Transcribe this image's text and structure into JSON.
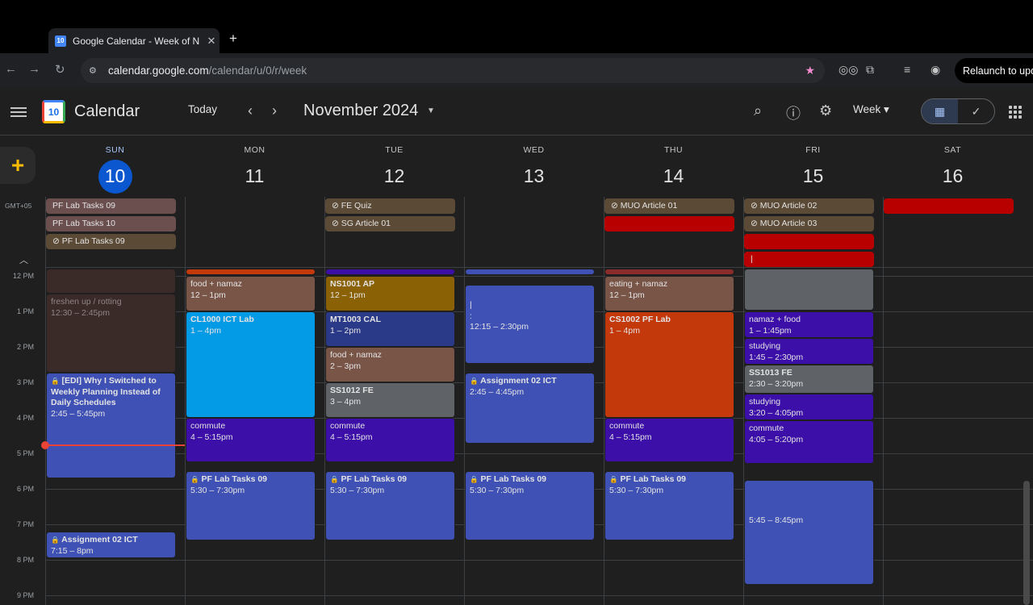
{
  "browser": {
    "tab_title": "Google Calendar - Week of N",
    "new_tab": "+",
    "url_host": "calendar.google.com",
    "url_path": "/calendar/u/0/r/week",
    "relaunch": "Relaunch to upd"
  },
  "header": {
    "app_name": "Calendar",
    "logo_day": "10",
    "today": "Today",
    "prev": "‹",
    "next": "›",
    "month": "November 2024",
    "view": "Week"
  },
  "timezone": "GMT+05",
  "days": [
    {
      "dow": "SUN",
      "num": "10"
    },
    {
      "dow": "MON",
      "num": "11"
    },
    {
      "dow": "TUE",
      "num": "12"
    },
    {
      "dow": "WED",
      "num": "13"
    },
    {
      "dow": "THU",
      "num": "14"
    },
    {
      "dow": "FRI",
      "num": "15"
    },
    {
      "dow": "SAT",
      "num": "16"
    }
  ],
  "hours": [
    "12 PM",
    "1 PM",
    "2 PM",
    "3 PM",
    "4 PM",
    "5 PM",
    "6 PM",
    "7 PM",
    "8 PM",
    "9 PM"
  ],
  "allday": {
    "sun1": "PF Lab Tasks 09",
    "sun2": "PF Lab Tasks 10",
    "sun3": "PF Lab Tasks 09",
    "tue1": "FE Quiz",
    "tue2": "SG Article 01",
    "thu1": "MUO Article 01",
    "fri1": "MUO Article 02",
    "fri2": "MUO Article 03",
    "fri4": "|"
  },
  "events": {
    "sun_fresh": {
      "title": "freshen up / rotting",
      "time": "12:30 – 2:45pm"
    },
    "sun_edi": {
      "title": "[EDI] Why I Switched to Weekly Planning Instead of Daily Schedules",
      "time": "2:45 – 5:45pm"
    },
    "sun_assign": {
      "title": "Assignment 02 ICT",
      "time": "7:15 – 8pm"
    },
    "mon_food": {
      "title": "food + namaz",
      "time": "12 – 1pm"
    },
    "mon_cl": {
      "title": "CL1000 ICT Lab",
      "time": "1 – 4pm"
    },
    "mon_commute": {
      "title": "commute",
      "time": "4 – 5:15pm"
    },
    "mon_pf": {
      "title": "PF Lab Tasks 09",
      "time": "5:30 – 7:30pm"
    },
    "tue_ns": {
      "title": "NS1001 AP",
      "time": "12 – 1pm"
    },
    "tue_mt": {
      "title": "MT1003 CAL",
      "time": "1 – 2pm"
    },
    "tue_food": {
      "title": "food + namaz",
      "time": "2 – 3pm"
    },
    "tue_ss": {
      "title": "SS1012 FE",
      "time": "3 – 4pm"
    },
    "tue_commute": {
      "title": "commute",
      "time": "4 – 5:15pm"
    },
    "tue_pf": {
      "title": "PF Lab Tasks 09",
      "time": "5:30 – 7:30pm"
    },
    "wed_untitled": {
      "line1": "|",
      "line2": ":",
      "time": "12:15 – 2:30pm"
    },
    "wed_assign": {
      "title": "Assignment 02 ICT",
      "time": "2:45 – 4:45pm"
    },
    "wed_pf": {
      "title": "PF Lab Tasks 09",
      "time": "5:30 – 7:30pm"
    },
    "thu_eat": {
      "title": "eating + namaz",
      "time": "12 – 1pm"
    },
    "thu_cs": {
      "title": "CS1002 PF Lab",
      "time": "1 – 4pm"
    },
    "thu_commute": {
      "title": "commute",
      "time": "4 – 5:15pm"
    },
    "thu_pf": {
      "title": "PF Lab Tasks 09",
      "time": "5:30 – 7:30pm"
    },
    "fri_namaz": {
      "title": "namaz + food",
      "time": "1 – 1:45pm"
    },
    "fri_study1": {
      "title": "studying",
      "time": "1:45 – 2:30pm"
    },
    "fri_ss": {
      "title": "SS1013 FE",
      "time": "2:30 – 3:20pm"
    },
    "fri_study2": {
      "title": "studying",
      "time": "3:20 – 4:05pm"
    },
    "fri_commute": {
      "title": "commute",
      "time": "4:05 – 5:20pm"
    },
    "fri_eve": {
      "time": "5:45 – 8:45pm"
    }
  },
  "colors": {
    "today_blue": "#0b57d0",
    "event_blue": "#3f51b5",
    "event_purple": "#3b0fa8",
    "event_cyan": "#039be5",
    "event_orange": "#c4390c",
    "event_gold": "#8a6104",
    "event_red": "#b80000",
    "event_brown": "#795548",
    "event_grey": "#5f6368",
    "now_line": "#ea4335"
  },
  "icons": [
    "back-icon",
    "forward-icon",
    "reload-icon",
    "site-info-icon",
    "bookmark-star-icon",
    "extension-icon",
    "profile-icon",
    "menu-icon",
    "search-icon",
    "help-icon",
    "settings-icon",
    "calendar-view-icon",
    "tasks-icon",
    "apps-icon",
    "task-check-icon",
    "lock-icon"
  ]
}
